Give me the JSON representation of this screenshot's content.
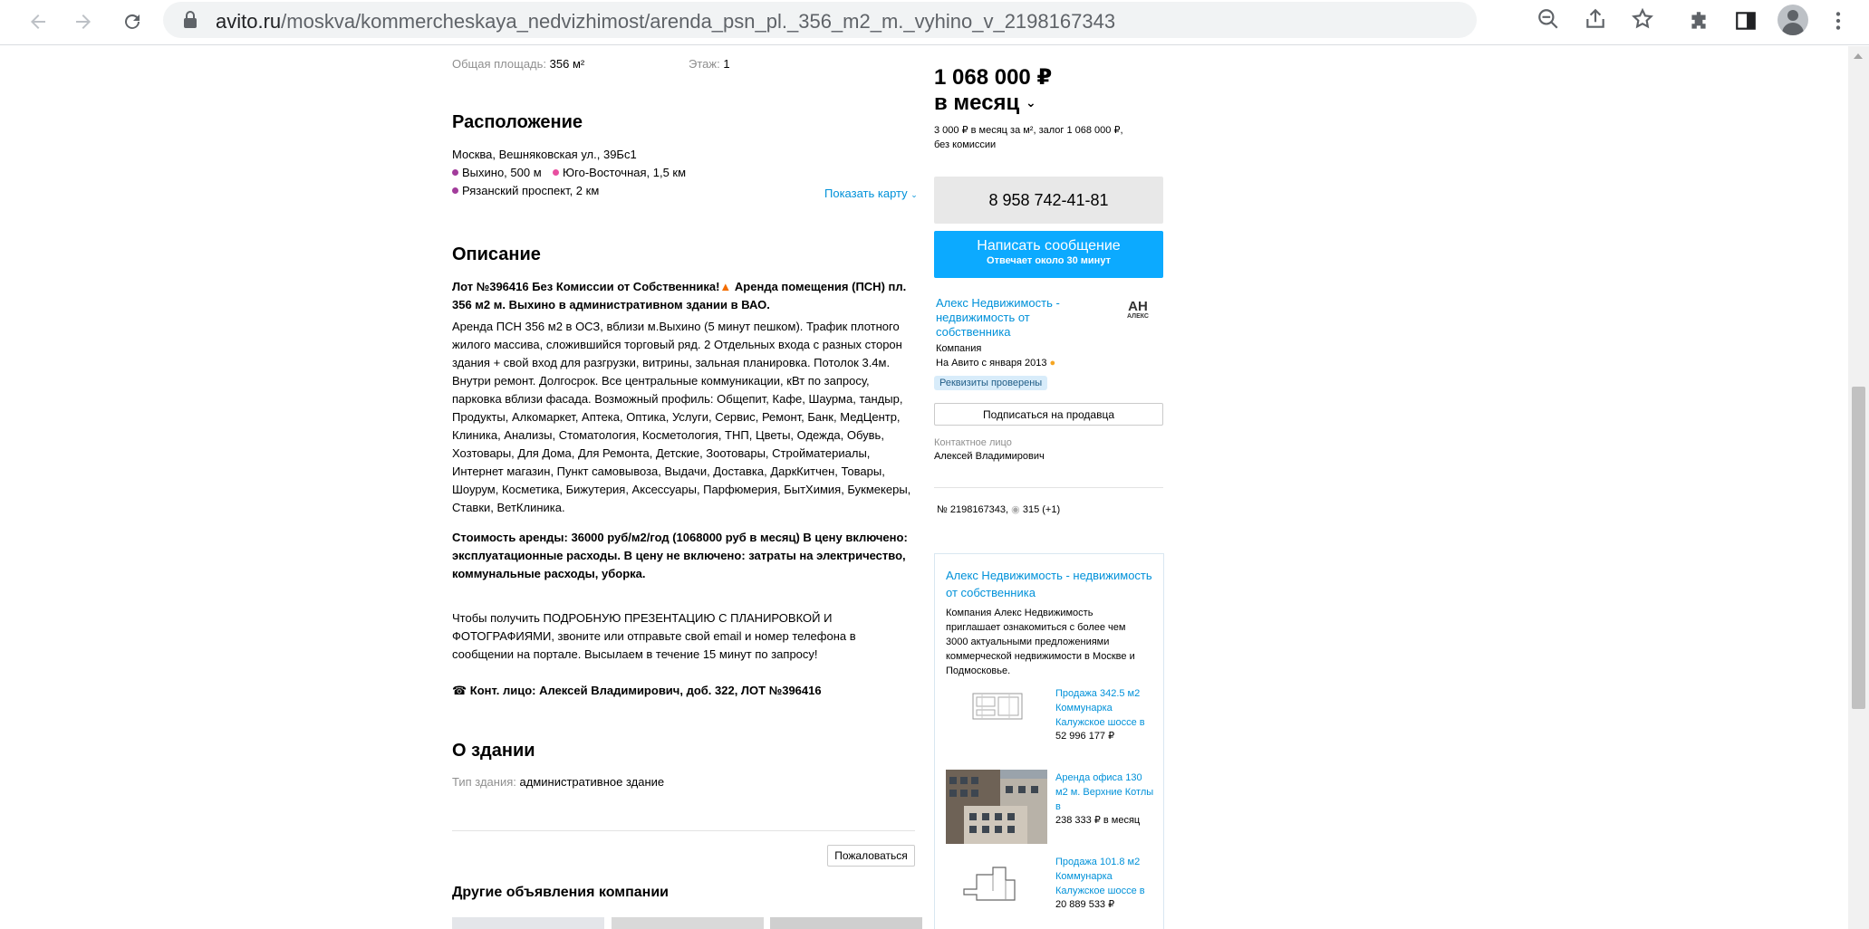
{
  "browser": {
    "url_host": "avito.ru",
    "url_path": "/moskva/kommercheskaya_nedvizhimost/arenda_psn_pl._356_m2_m._vyhino_v_2198167343"
  },
  "top_params": {
    "area_label": "Общая площадь:",
    "area_value": "356 м²",
    "floor_label": "Этаж:",
    "floor_value": "1"
  },
  "location": {
    "title": "Расположение",
    "address": "Москва, Вешняковская ул., 39Бс1",
    "metro": [
      {
        "text": "Выхино, 500 м",
        "color": "#a23c9b"
      },
      {
        "text": "Юго-Восточная, 1,5 км",
        "color": "#e84fa0"
      },
      {
        "text": "Рязанский проспект, 2 км",
        "color": "#a23c9b"
      }
    ],
    "show_map": "Показать карту"
  },
  "description": {
    "title": "Описание",
    "headline_1": "Лот №396416 Без Комиссии от Собственника!",
    "headline_2": " Аренда помещения (ПСН) пл.",
    "headline_3": "356 м2 м. Выхино в административном здании в ВАО.",
    "body_lines": [
      "Аренда ПСН 356 м2 в ОСЗ, вблизи м.Выхино (5 минут пешком). Трафик плотного",
      "жилого массива, сложившийся торговый ряд. 2 Отдельных входа с разных сторон",
      "здания + свой вход для разгрузки, витрины, зальная планировка. Потолок 3.4м.",
      "Внутри ремонт. Долгосрок. Все центральные коммуникации, кВт по запросу,",
      "парковка вблизи фасада. Возможный профиль: Общепит, Кафе, Шаурма, тандыр,",
      "Продукты, Алкомаркет, Аптека, Оптика, Услуги, Сервис, Ремонт, Банк, МедЦентр,",
      "Клиника, Анализы, Стоматология, Косметология, ТНП, Цветы, Одежда, Обувь,",
      "Хозтовары, Для Дома, Для Ремонта, Детские, Зоотовары, Стройматериалы,",
      "Интернет магазин, Пункт самовывоза, Выдачи, Доставка, ДаркКитчен, Товары,",
      "Шоурум, Косметика, Бижутерия, Аксессуары, Парфюмерия, БытХимия, Букмекеры,",
      "Ставки, ВетКлиника."
    ],
    "cost_lines": [
      "Стоимость аренды: 36000 руб/м2/год (1068000 руб в месяц) В цену включено:",
      "эксплуатационные расходы. В цену не включено: затраты на электричество,",
      "коммунальные расходы, уборка."
    ],
    "presentation_lines": [
      "Чтобы получить ПОДРОБНУЮ ПРЕЗЕНТАЦИЮ С ПЛАНИРОВКОЙ И",
      "ФОТОГРАФИЯМИ, звоните или отправьте свой email и номер телефона в",
      "сообщении на портале. Высылаем в течение 15 минут по запросу!"
    ],
    "contact_line": "☎ Конт. лицо: Алексей Владимирович, доб. 322, ЛОТ №396416"
  },
  "building": {
    "title": "О здании",
    "type_label": "Тип здания:",
    "type_value": "административное здание"
  },
  "complain_button": "Пожаловаться",
  "other_ads_title": "Другие объявления компании",
  "sidebar": {
    "price": "1 068 000 ₽",
    "period": "в месяц",
    "price_note_1": "3 000 ₽ в месяц за м², залог 1 068 000 ₽,",
    "price_note_2": "без комиссии",
    "phone": "8 958 742-41-81",
    "message_button": "Написать сообщение",
    "message_sub": "Отвечает около 30 минут",
    "seller_name_lines": [
      "Алекс Недвижимость -",
      "недвижимость от",
      "собственника"
    ],
    "seller_type": "Компания",
    "on_avito": "На Авито с января 2013",
    "verified_badge": "Реквизиты проверены",
    "logo_text_top": "АН",
    "logo_text_bottom": "АЛЕКС",
    "subscribe_button": "Подписаться на продавца",
    "contact_label": "Контактное лицо",
    "contact_name": "Алексей Владимирович",
    "ad_number": "№ 2198167343,",
    "views": "315 (+1)"
  },
  "company_card": {
    "title_lines": [
      "Алекс Недвижимость - недвижимость",
      "от собственника"
    ],
    "text_lines": [
      "Компания Алекс Недвижимость",
      "приглашает ознакомиться с более чем",
      "3000 актуальными предложениями",
      "коммерческой недвижимости в Москве и",
      "Подмосковье."
    ],
    "items": [
      {
        "title_lines": [
          "Продажа 342.5 м2",
          "Коммунарка",
          "Калужское шоссе в"
        ],
        "price": "52 996 177 ₽"
      },
      {
        "title_lines": [
          "Аренда офиса 130",
          "м2 м. Верхние Котлы",
          "в"
        ],
        "price": "238 333 ₽ в месяц"
      },
      {
        "title_lines": [
          "Продажа 101.8 м2",
          "Коммунарка",
          "Калужское шоссе в"
        ],
        "price": "20 889 533 ₽"
      }
    ]
  }
}
